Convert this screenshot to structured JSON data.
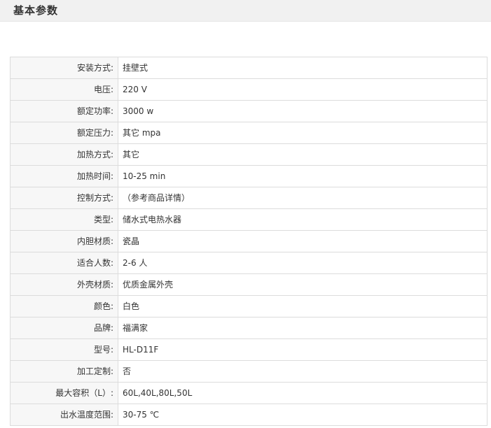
{
  "section": {
    "title": "基本参数"
  },
  "params": [
    {
      "label": "安装方式:",
      "value": "挂壁式"
    },
    {
      "label": "电压:",
      "value": "220 V"
    },
    {
      "label": "额定功率:",
      "value": "3000 w"
    },
    {
      "label": "额定压力:",
      "value": "其它 mpa"
    },
    {
      "label": "加热方式:",
      "value": "其它"
    },
    {
      "label": "加热时间:",
      "value": "10-25 min"
    },
    {
      "label": "控制方式:",
      "value": "（参考商品详情）"
    },
    {
      "label": "类型:",
      "value": "储水式电热水器"
    },
    {
      "label": "内胆材质:",
      "value": "瓷晶"
    },
    {
      "label": "适合人数:",
      "value": "2-6 人"
    },
    {
      "label": "外壳材质:",
      "value": "优质金属外壳"
    },
    {
      "label": "颜色:",
      "value": "白色"
    },
    {
      "label": "品牌:",
      "value": "福满家"
    },
    {
      "label": "型号:",
      "value": "HL-D11F"
    },
    {
      "label": "加工定制:",
      "value": "否"
    },
    {
      "label": "最大容积（L）:",
      "value": "60L,40L,80L,50L"
    },
    {
      "label": "出水温度范围:",
      "value": "30-75 ℃"
    }
  ]
}
